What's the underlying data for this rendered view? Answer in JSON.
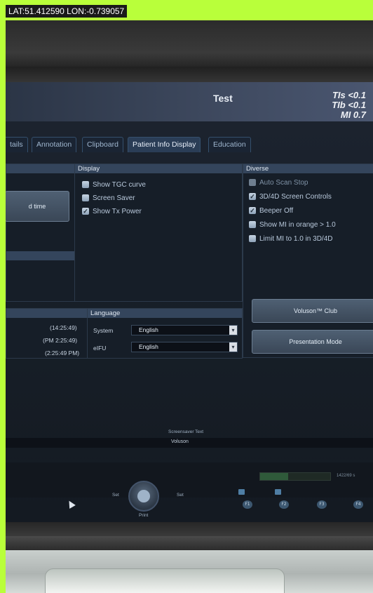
{
  "gps_overlay": "LAT:51.412590 LON:-0.739057",
  "header": {
    "title": "Test",
    "indices": [
      "TIs <0.1",
      "TIb <0.1",
      "MI  0.7"
    ]
  },
  "tabs": [
    "tails",
    "Annotation",
    "Clipboard",
    "Patient Info Display",
    "Education"
  ],
  "left_panel": {
    "button_label": "d time",
    "times": [
      "(14:25:49)",
      "(PM 2:25:49)",
      "(2:25:49 PM)"
    ]
  },
  "display": {
    "title": "Display",
    "items": [
      {
        "label": "Show TGC curve",
        "checked": false
      },
      {
        "label": "Screen Saver",
        "checked": false
      },
      {
        "label": "Show Tx Power",
        "checked": true
      }
    ]
  },
  "diverse": {
    "title": "Diverse",
    "items": [
      {
        "label": "Auto Scan Stop",
        "checked": false
      },
      {
        "label": "3D/4D Screen Controls",
        "checked": true
      },
      {
        "label": "Beeper Off",
        "checked": true
      },
      {
        "label": "Show MI in orange > 1.0",
        "checked": false
      },
      {
        "label": "Limit MI to 1.0 in 3D/4D",
        "checked": false
      }
    ],
    "buttons": [
      "Voluson™ Club",
      "Presentation Mode"
    ]
  },
  "language": {
    "title": "Language",
    "rows": [
      {
        "label": "System",
        "value": "English"
      },
      {
        "label": "eIFU",
        "value": "English"
      }
    ]
  },
  "screensaver": {
    "label": "Screensaver Text",
    "value": "Voluson"
  },
  "status": {
    "progress_label": "1422/69 s",
    "progress": 0.4
  },
  "bottom_controls": {
    "set_left": "Set",
    "set_right": "Set",
    "print": "Print",
    "fkeys": [
      "F1",
      "F2",
      "F3",
      "F4"
    ]
  }
}
